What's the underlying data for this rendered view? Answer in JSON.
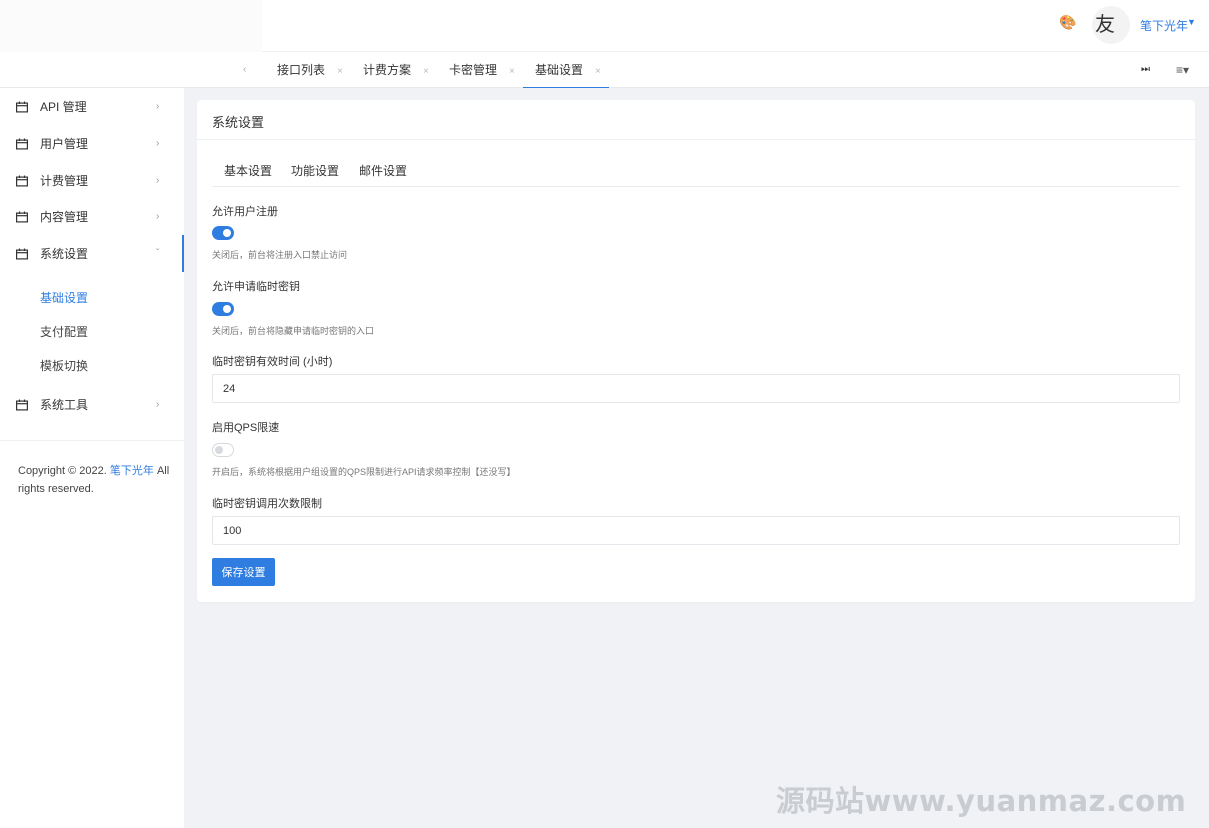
{
  "header": {
    "user_name": "笔下光年",
    "avatar_glyph": "友年"
  },
  "tabs": {
    "items": [
      {
        "label": "接口列表"
      },
      {
        "label": "计费方案"
      },
      {
        "label": "卡密管理"
      },
      {
        "label": "基础设置"
      }
    ],
    "close_glyph": "×",
    "active": "基础设置"
  },
  "sidebar": {
    "items": [
      {
        "label": "API 管理"
      },
      {
        "label": "用户管理"
      },
      {
        "label": "计费管理"
      },
      {
        "label": "内容管理"
      },
      {
        "label": "系统设置"
      },
      {
        "label": "系统工具"
      }
    ],
    "sub_items": [
      {
        "label": "基础设置"
      },
      {
        "label": "支付配置"
      },
      {
        "label": "模板切换"
      }
    ],
    "copyright_prefix": "Copyright © 2022.",
    "copyright_brand": "笔下光年",
    "copyright_suffix": "All rights reserved."
  },
  "card": {
    "title": "系统设置",
    "subtabs": [
      {
        "label": "基本设置"
      },
      {
        "label": "功能设置"
      },
      {
        "label": "邮件设置"
      }
    ],
    "active_subtab": "功能设置",
    "fields": {
      "allow_register": {
        "label": "允许用户注册",
        "enabled": true,
        "hint": "关闭后，前台将注册入口禁止访问"
      },
      "allow_temp_key": {
        "label": "允许申请临时密钥",
        "enabled": true,
        "hint": "关闭后，前台将隐藏申请临时密钥的入口"
      },
      "temp_key_ttl": {
        "label": "临时密钥有效时间 (小时)",
        "value": "24"
      },
      "qps_limit": {
        "label": "启用QPS限速",
        "enabled": false,
        "hint": "开启后，系统将根据用户组设置的QPS限制进行API请求频率控制【还没写】"
      },
      "temp_key_call_limit": {
        "label": "临时密钥调用次数限制",
        "value": "100"
      }
    },
    "save_label": "保存设置"
  },
  "watermark": "源码站www.yuanmaz.com",
  "colors": {
    "accent": "#2f7de1",
    "background": "#f0f2f5"
  }
}
